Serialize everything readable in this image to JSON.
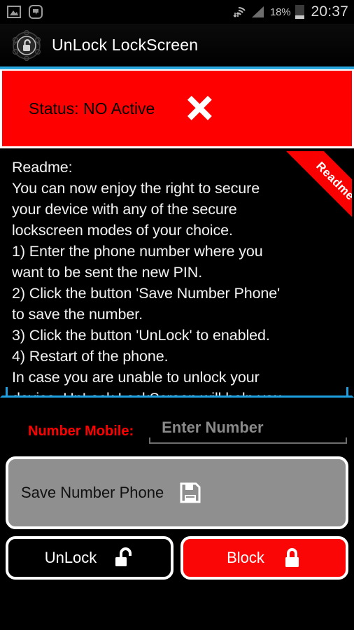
{
  "status_bar": {
    "icons_left": [
      "gallery-icon",
      "media-player-icon"
    ],
    "wifi_icon": "wifi-transfer-icon",
    "signal_icon": "cell-signal-icon",
    "battery_percent": "18%",
    "battery_icon": "battery-low-icon",
    "clock": "20:37"
  },
  "title_bar": {
    "icon": "unlock-padlock-app-icon",
    "title": "UnLock LockScreen",
    "accent_color": "#29a8e0"
  },
  "status_banner": {
    "text": "Status: NO Active",
    "icon": "x-mark-icon",
    "background_color": "#ff0000",
    "text_color": "#000000"
  },
  "readme": {
    "ribbon_label": "Readme",
    "ribbon_color": "#fa0000",
    "body": "Readme:\nYou can now enjoy the right to secure\nyour device with any of the secure\nlockscreen modes of your choice.\n1) Enter the phone number where you\nwant to be sent the new PIN.\n2) Click the button 'Save Number Phone'\nto save the number.\n3) Click the button 'UnLock' to enabled.\n4) Restart of the phone.\nIn case you are unable to unlock your\ndevice, UnLock LockScreen will help you",
    "border_color": "#1e9fe0"
  },
  "number_field": {
    "label": "Number Mobile:",
    "label_color": "#ff0000",
    "placeholder": "Enter Number",
    "value": ""
  },
  "save_button": {
    "label": "Save Number Phone",
    "icon": "floppy-disk-save-icon",
    "background_color": "#8f8f8f"
  },
  "bottom_buttons": [
    {
      "label": "UnLock",
      "icon": "open-padlock-icon",
      "background_color": "#000000"
    },
    {
      "label": "Block",
      "icon": "closed-padlock-icon",
      "background_color": "#fb0606"
    }
  ]
}
